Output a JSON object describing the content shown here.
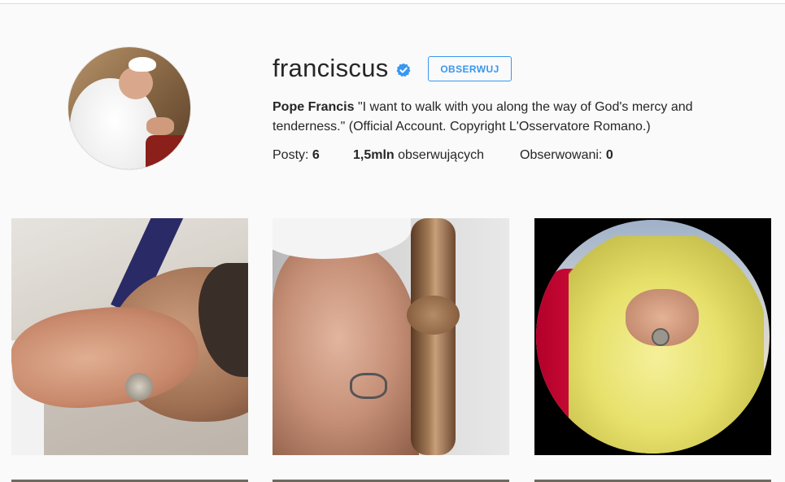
{
  "profile": {
    "username": "franciscus",
    "verified_icon": "verified-badge-icon",
    "follow_label": "OBSERWUJ",
    "full_name": "Pope Francis",
    "bio_text": "\"I want to walk with you along the way of God's mercy and tenderness.\" (Official Account. Copyright L'Osservatore Romano.)"
  },
  "stats": {
    "posts_label": "Posty: ",
    "posts_value": "6",
    "followers_value": "1,5mln",
    "followers_label": " obserwujących",
    "following_label": "Obserwowani: ",
    "following_value": "0"
  },
  "colors": {
    "accent": "#3897f0",
    "text": "#262626",
    "background": "#fafafa"
  },
  "posts": [
    {
      "name": "post-hand-on-face"
    },
    {
      "name": "post-pope-praying-staff"
    },
    {
      "name": "post-palm-branches"
    }
  ]
}
